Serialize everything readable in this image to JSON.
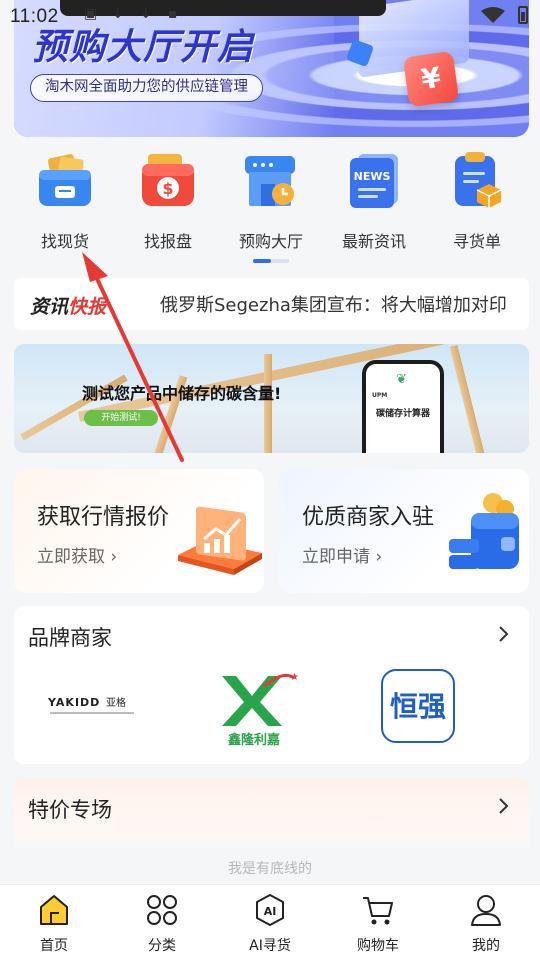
{
  "status_bar": {
    "time": "11:02"
  },
  "banner": {
    "title": "预购大厅开启",
    "subtitle": "淘木网全面助力您的供应链管理",
    "yen_symbol": "¥"
  },
  "quick_actions": [
    {
      "label": "找现货",
      "icon": "wallet-box-icon"
    },
    {
      "label": "找报盘",
      "icon": "money-bag-icon"
    },
    {
      "label": "预购大厅",
      "icon": "shop-clock-icon"
    },
    {
      "label": "最新资讯",
      "icon": "news-icon"
    },
    {
      "label": "寻货单",
      "icon": "clipboard-box-icon"
    }
  ],
  "ticker": {
    "tag_part1": "资讯",
    "tag_part2": "快报",
    "text": "俄罗斯Segezha集团宣布：将大幅增加对印"
  },
  "carbon_banner": {
    "title": "测试您产品中储存的碳含量!",
    "button": "开始测试!",
    "phone_brand": "UPM",
    "phone_title": "碳储存计算器"
  },
  "promo_cards": [
    {
      "title": "获取行情报价",
      "link": "立即获取 ›"
    },
    {
      "title": "优质商家入驻",
      "link": "立即申请 ›"
    }
  ],
  "brands": {
    "title": "品牌商家",
    "logos": [
      {
        "name": "YAKIDD 亚格",
        "text": "YAKIDD 亚格"
      },
      {
        "name": "鑫隆利嘉",
        "text": "鑫隆利嘉"
      },
      {
        "name": "恒强",
        "text": "恒强"
      }
    ]
  },
  "special": {
    "title": "特价专场"
  },
  "footer_note": "我是有底线的",
  "tabs": [
    {
      "label": "首页",
      "active": true
    },
    {
      "label": "分类",
      "active": false
    },
    {
      "label": "AI寻货",
      "active": false
    },
    {
      "label": "购物车",
      "active": false
    },
    {
      "label": "我的",
      "active": false
    }
  ],
  "colors": {
    "accent_blue": "#2f6fe4",
    "annotation_red": "#e53935",
    "tab_active_yellow": "#ffcc33"
  }
}
